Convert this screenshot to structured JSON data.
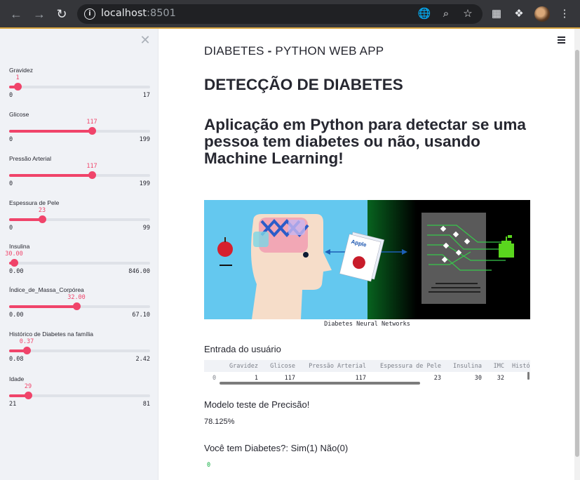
{
  "browser": {
    "url_host": "localhost",
    "url_port": ":8501"
  },
  "sidebar": {
    "sliders": [
      {
        "label": "Gravidez",
        "value": "1",
        "min": "0",
        "max": "17",
        "fraction": 0.059
      },
      {
        "label": "Glicose",
        "value": "117",
        "min": "0",
        "max": "199",
        "fraction": 0.588
      },
      {
        "label": "Pressão Arterial",
        "value": "117",
        "min": "0",
        "max": "199",
        "fraction": 0.588
      },
      {
        "label": "Espessura de Pele",
        "value": "23",
        "min": "0",
        "max": "99",
        "fraction": 0.232
      },
      {
        "label": "Insulina",
        "value": "30.00",
        "min": "0.00",
        "max": "846.00",
        "fraction": 0.035
      },
      {
        "label": "Índice_de_Massa_Corpórea",
        "value": "32.00",
        "min": "0.00",
        "max": "67.10",
        "fraction": 0.477
      },
      {
        "label": "Histórico de Diabetes na família",
        "value": "0.37",
        "min": "0.08",
        "max": "2.42",
        "fraction": 0.124
      },
      {
        "label": "Idade",
        "value": "29",
        "min": "21",
        "max": "81",
        "fraction": 0.133
      }
    ]
  },
  "main": {
    "app_title_a": "DIABETES",
    "app_title_b": " - ",
    "app_title_c": "PYTHON WEB APP",
    "h1": "DETECÇÃO DE DIABETES",
    "h2": "Aplicação em Python para detectar se uma pessoa tem diabetes ou não, usando Machine Learning!",
    "image_caption": "Diabetes Neural Networks",
    "image_apple_text": "Apple",
    "user_input_label": "Entrada do usuário",
    "table": {
      "columns": [
        "Gravidez",
        "Glicose",
        "Pressão Arterial",
        "Espessura de Pele",
        "Insulina",
        "IMC",
        "Histó"
      ],
      "index": "0",
      "row": [
        "1",
        "117",
        "117",
        "23",
        "30",
        "32",
        ""
      ]
    },
    "accuracy_label": "Modelo teste de Precisão!",
    "accuracy_value": "78.125%",
    "prediction_label": "Você tem Diabetes?: Sim(1) Não(0)",
    "prediction_value": "0"
  },
  "colors": {
    "accent": "#f0446a",
    "sidebar_bg": "#f0f2f6",
    "text": "#262730",
    "success": "#09ab3b"
  }
}
